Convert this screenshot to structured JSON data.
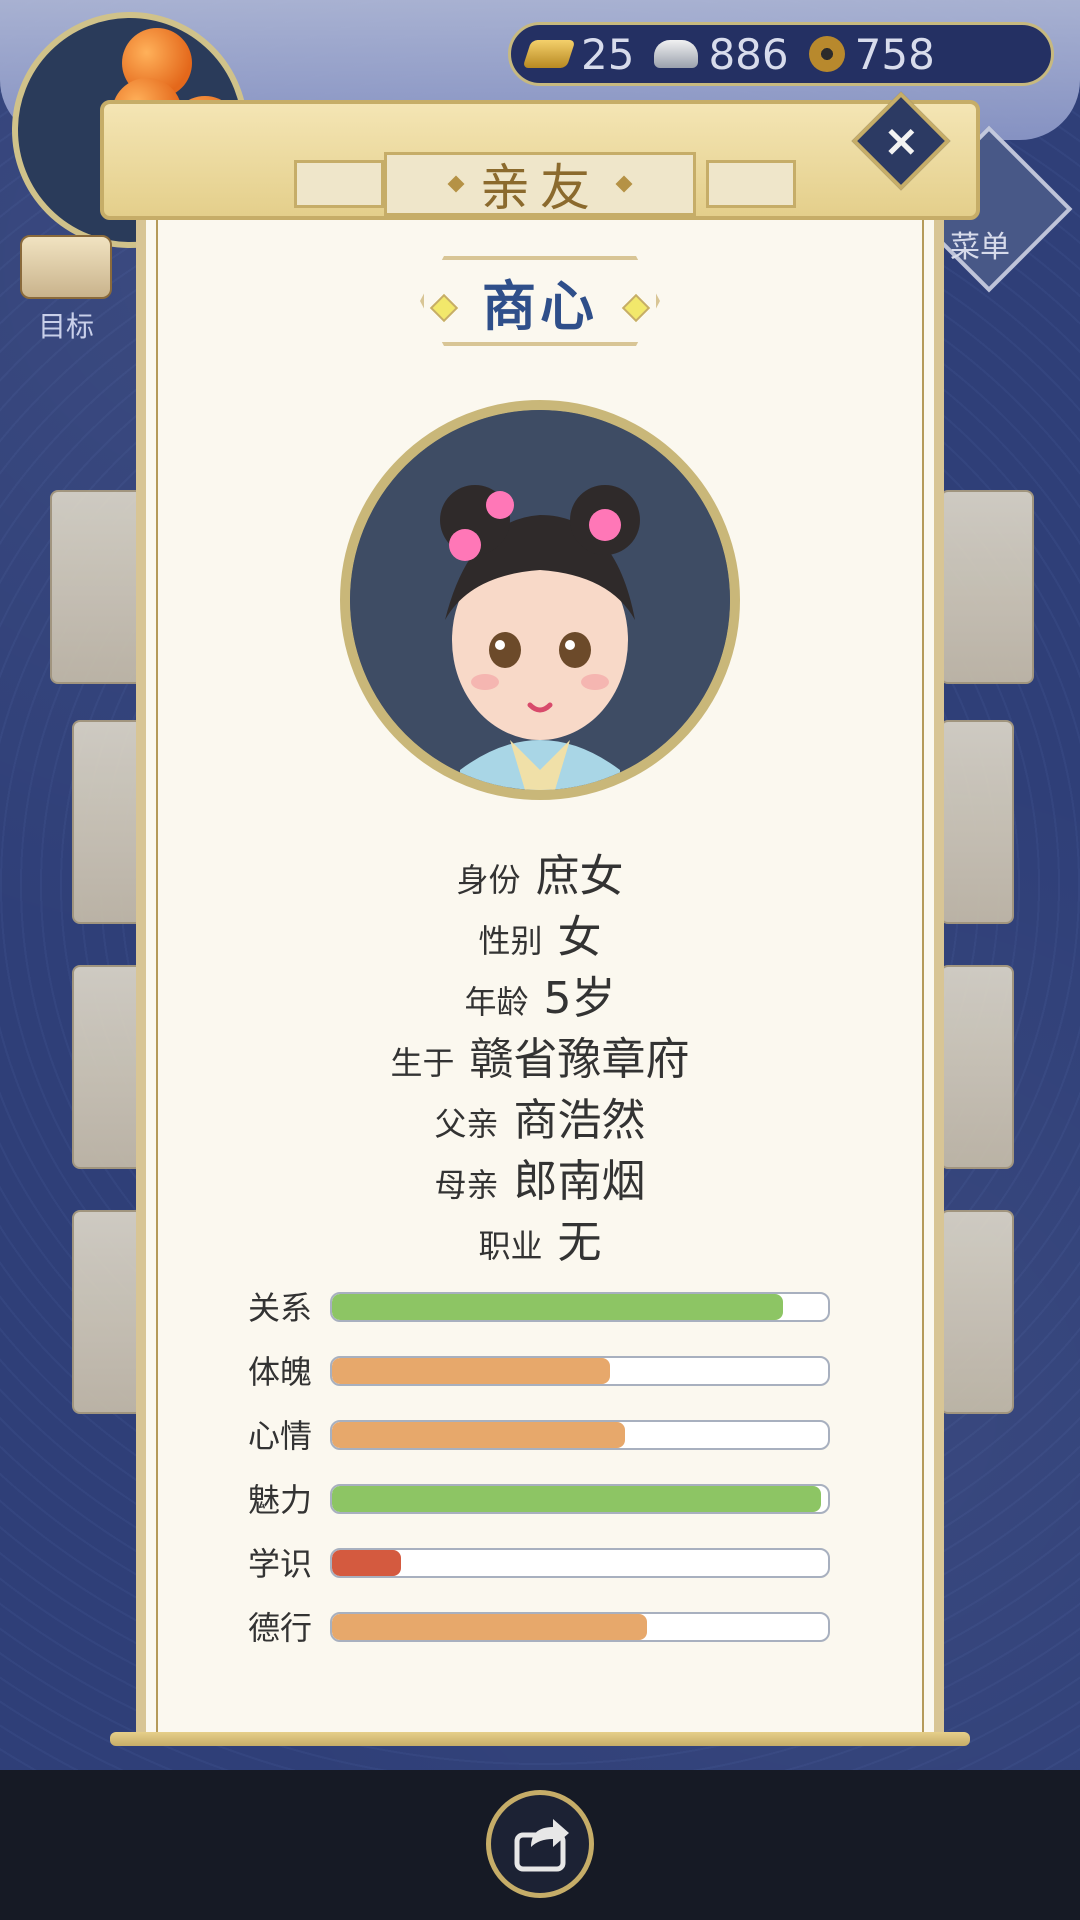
{
  "currency": {
    "gold": "25",
    "silver": "886",
    "copper": "758"
  },
  "left_menu": {
    "goal_label": "目标"
  },
  "right_menu": {
    "menu_label": "菜单"
  },
  "panel": {
    "title": "亲友",
    "name": "商心"
  },
  "info": [
    {
      "label": "身份",
      "value": "庶女"
    },
    {
      "label": "性别",
      "value": "女"
    },
    {
      "label": "年龄",
      "value": "5岁"
    },
    {
      "label": "生于",
      "value": "赣省豫章府"
    },
    {
      "label": "父亲",
      "value": "商浩然"
    },
    {
      "label": "母亲",
      "value": "郎南烟"
    },
    {
      "label": "职业",
      "value": "无"
    }
  ],
  "stats": [
    {
      "label": "关系",
      "fill": 0.91,
      "color": "#8dc564"
    },
    {
      "label": "体魄",
      "fill": 0.56,
      "color": "#e7a86b"
    },
    {
      "label": "心情",
      "fill": 0.59,
      "color": "#e7a86b"
    },
    {
      "label": "魅力",
      "fill": 0.985,
      "color": "#8dc564"
    },
    {
      "label": "学识",
      "fill": 0.14,
      "color": "#d45a3f"
    },
    {
      "label": "德行",
      "fill": 0.635,
      "color": "#e7a86b"
    }
  ],
  "colors": {
    "background": "#2f3f78",
    "paper": "#fbf8ef",
    "accent_gold": "#c6ad68",
    "name_blue": "#2f4f8a"
  },
  "icons": [
    "gold-ingot-icon",
    "silver-ingot-icon",
    "copper-coin-icon",
    "close-icon",
    "share-icon",
    "scroll-icon",
    "menu-diamond-icon",
    "candied-hawthorn-icon"
  ]
}
